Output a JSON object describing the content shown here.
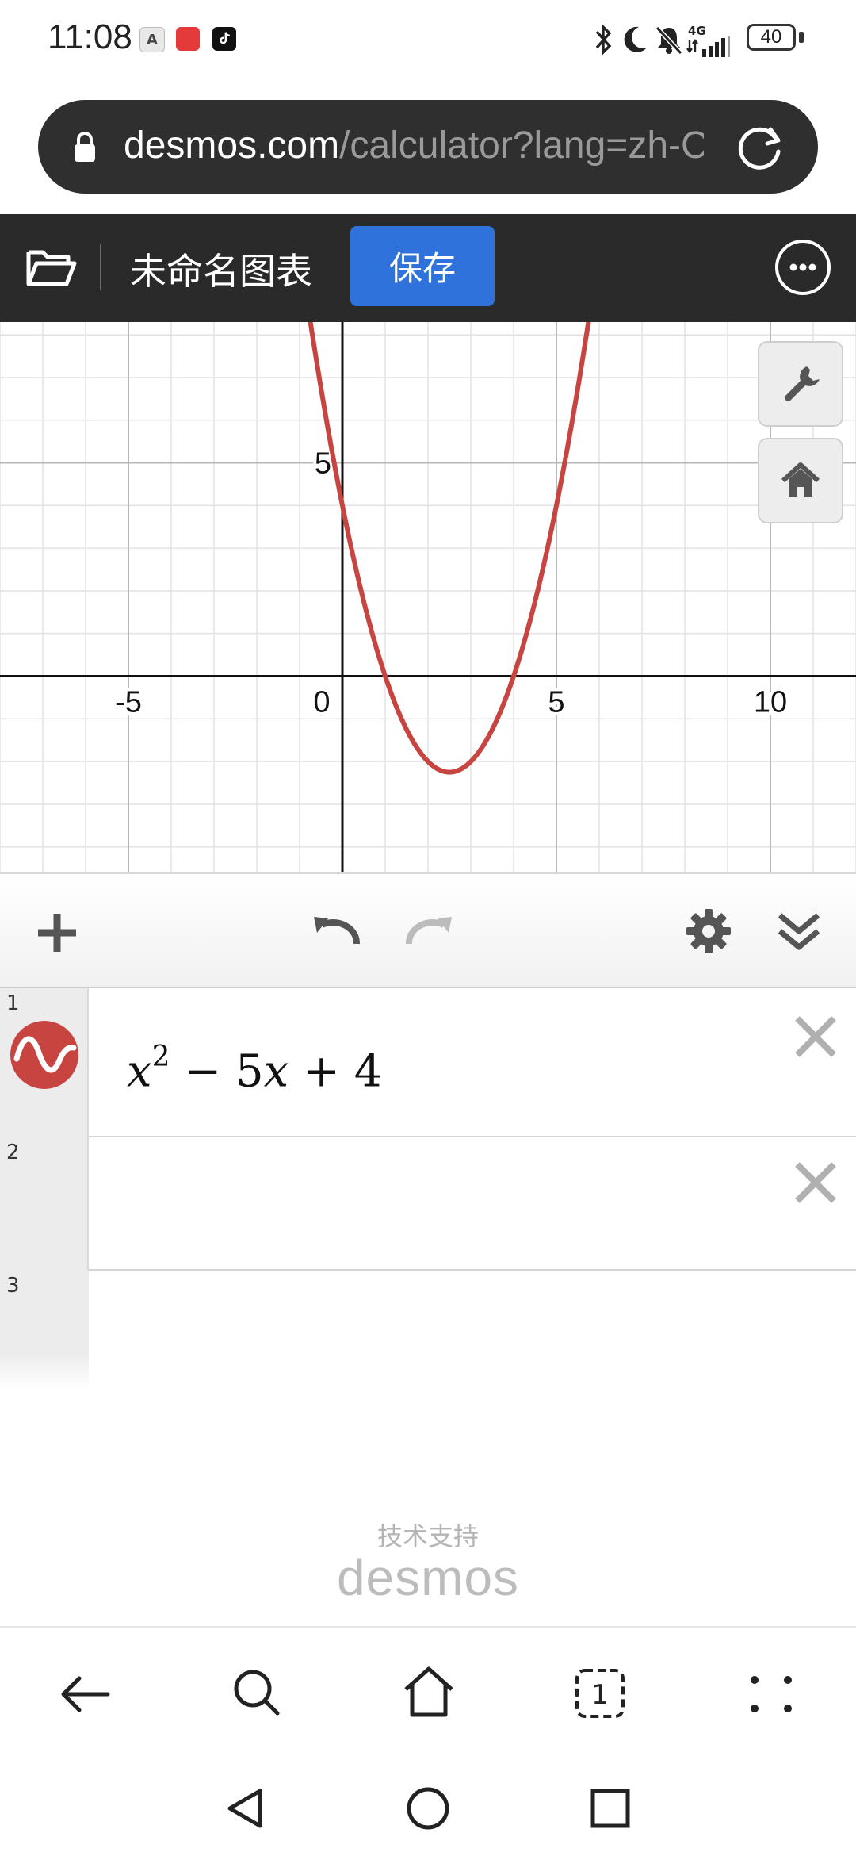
{
  "status_bar": {
    "time": "11:08",
    "app_icons": [
      "A",
      "HUAWEI",
      "tiktok-icon"
    ],
    "indicators": [
      "bluetooth-icon",
      "moon-icon",
      "bell-muted-icon",
      "signal-4g-icon"
    ],
    "network": "4G",
    "battery": "40"
  },
  "browser": {
    "url_host": "desmos.com",
    "url_path": "/calculator?lang=zh-C"
  },
  "header": {
    "graph_title": "未命名图表",
    "save_label": "保存"
  },
  "graph": {
    "x_ticks": [
      "-5",
      "0",
      "5",
      "10"
    ],
    "y_ticks": [
      "5"
    ],
    "curve_color": "#c74440"
  },
  "chart_data": {
    "type": "line",
    "series": [
      {
        "expression": "x^2 - 5x + 4",
        "color": "#c74440"
      }
    ],
    "x_ticks": [
      -5,
      0,
      5,
      10
    ],
    "y_ticks": [
      5
    ],
    "xlim": [
      -8,
      12
    ],
    "ylim": [
      -4.6,
      8.3
    ],
    "grid": true,
    "minor_grid": true
  },
  "expressions": [
    {
      "number": "1",
      "latex": "x^2 - 5x + 4",
      "color": "#c74440"
    },
    {
      "number": "2",
      "latex": ""
    },
    {
      "number": "3",
      "latex": ""
    }
  ],
  "expr_parts": {
    "x": "x",
    "exp": "2",
    "rest": " − 5",
    "x2": "x",
    "tail": " + 4"
  },
  "footer": {
    "powered_by": "技术支持",
    "brand": "desmos"
  },
  "colors": {
    "header_bg": "#2a2a2a",
    "save_button": "#2f72dc",
    "urlbar_bg": "#2f2f2f"
  }
}
